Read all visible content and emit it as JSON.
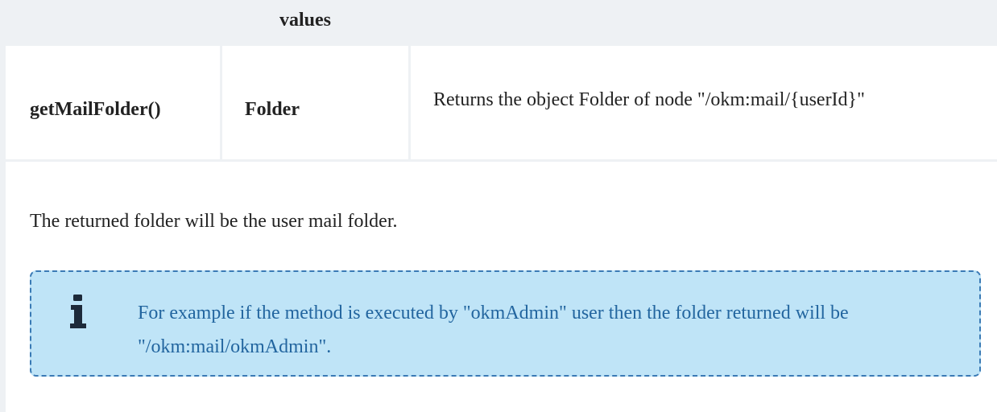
{
  "table": {
    "header": "values",
    "row": {
      "method": "getMailFolder()",
      "type": "Folder",
      "description": "Returns the object Folder of node \"/okm:mail/{userId}\""
    }
  },
  "paragraph": "The returned folder will be the user mail folder.",
  "info_note": {
    "icon": "info-icon",
    "text": "For example if the method is executed by \"okmAdmin\" user then the folder returned will be \"/okm:mail/okmAdmin\"."
  },
  "colors": {
    "header_bg": "#eef1f4",
    "info_bg": "#bfe4f7",
    "info_border": "#3a7ab5",
    "info_text": "#22659f"
  }
}
